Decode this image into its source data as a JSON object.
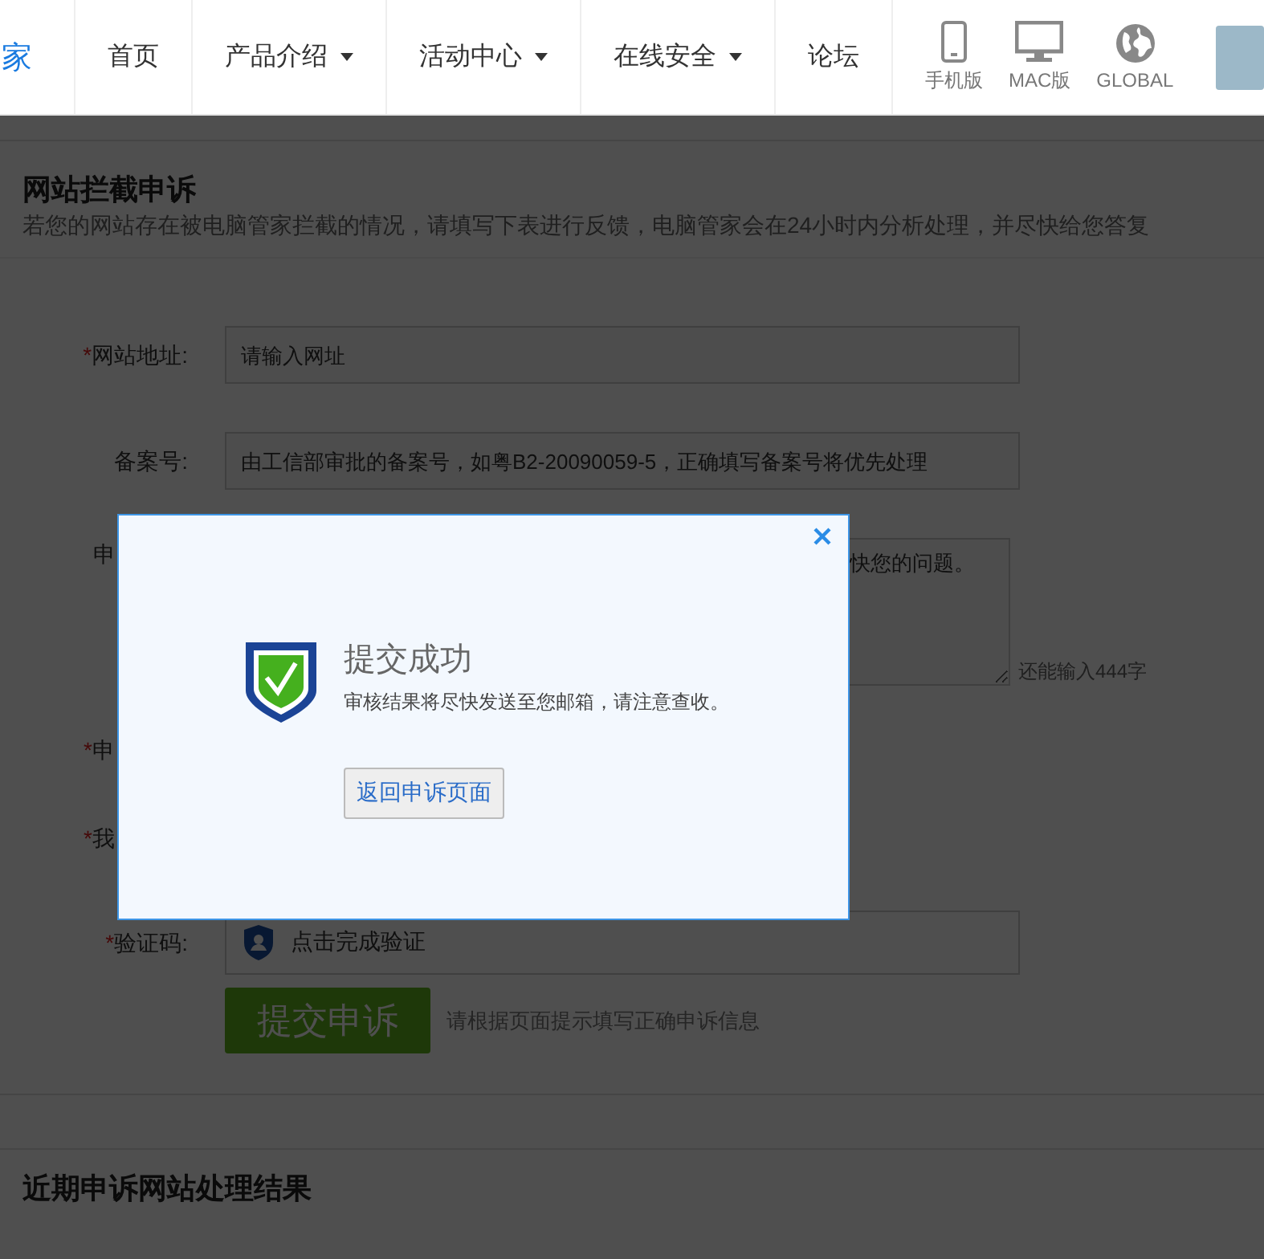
{
  "nav": {
    "logo_fragment": "家",
    "items": [
      {
        "label": "首页",
        "dropdown": false
      },
      {
        "label": "产品介绍",
        "dropdown": true
      },
      {
        "label": "活动中心",
        "dropdown": true
      },
      {
        "label": "在线安全",
        "dropdown": true
      },
      {
        "label": "论坛",
        "dropdown": false
      }
    ],
    "platforms": [
      {
        "kind": "phone",
        "label": "手机版"
      },
      {
        "kind": "desktop",
        "label": "MAC版"
      },
      {
        "kind": "globe",
        "label": "GLOBAL"
      }
    ]
  },
  "form": {
    "title": "网站拦截申诉",
    "description": "若您的网站存在被电脑管家拦截的情况，请填写下表进行反馈，电脑管家会在24小时内分析处理，并尽快给您答复",
    "fields": [
      {
        "kind": "input",
        "mark": "*",
        "label": "网站地址:",
        "placeholder": "请输入网址"
      },
      {
        "kind": "input",
        "label": "备案号:",
        "placeholder": "由工信部审批的备案号，如粤B2-20090059-5，正确填写备案号将优先处理"
      },
      {
        "kind": "textarea",
        "label": "申",
        "placeholder": "快您的问题。",
        "counter": "还能输入444字"
      },
      {
        "kind": "covered",
        "mark": "*",
        "label": "申"
      },
      {
        "kind": "covered",
        "mark": "*",
        "label": "我"
      },
      {
        "kind": "captcha",
        "mark": "*",
        "label": "验证码:",
        "text": "点击完成验证"
      }
    ],
    "submit": {
      "label": "提交申诉",
      "hint": "请根据页面提示填写正确申诉信息"
    }
  },
  "results": {
    "title": "近期申诉网站处理结果"
  },
  "dialog": {
    "title": "提交成功",
    "message": "审核结果将尽快发送至您邮箱，请注意查收。",
    "button": "返回申诉页面"
  }
}
